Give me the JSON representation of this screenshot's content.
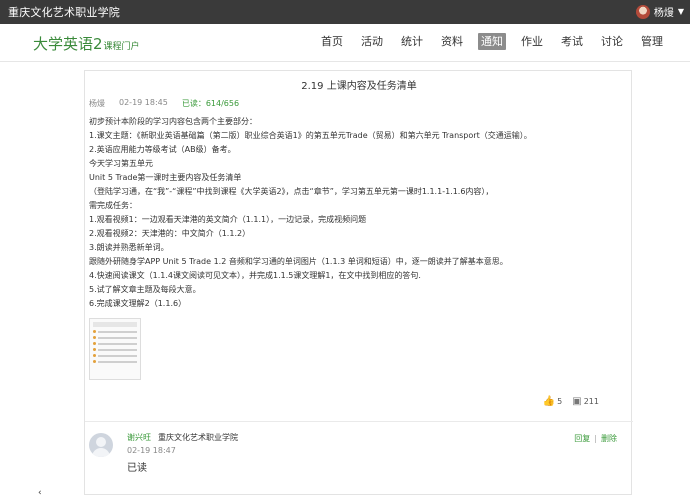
{
  "topbar": {
    "school_name": "重庆文化艺术职业学院",
    "user_name": "杨熳"
  },
  "header": {
    "brand_name": "大学英语2",
    "brand_sub": "课程门户",
    "nav": [
      "首页",
      "活动",
      "统计",
      "资料",
      "通知",
      "作业",
      "考试",
      "讨论",
      "管理"
    ],
    "active_nav": "通知"
  },
  "post": {
    "title": "2.19 上课内容及任务清单",
    "author": "杨熳",
    "time": "02-19 18:45",
    "read_status": "已读：614/656",
    "lines": [
      "初步预计本阶段的学习内容包含两个主要部分：",
      "1.课文主题：《新职业英语基础篇（第二版）职业综合英语1》的第五单元Trade（贸易）和第六单元 Transport（交通运输）。",
      "2.英语应用能力等级考试（AB级）备考。",
      "今天学习第五单元",
      "Unit 5 Trade第一课时主要内容及任务清单",
      "（登陆学习通，在“我”-“课程”中找到课程《大学英语2》，点击“章节”，学习第五单元第一课时1.1.1-1.1.6内容），",
      "需完成任务：",
      "1.观看视频1：一边观看天津港的英文简介（1.1.1），一边记录，完成视频问题",
      "2.观看视频2：天津港的：中文简介（1.1.2）",
      "3.朗读并熟悉新单词。",
      "跟随外研随身学APP  Unit 5 Trade 1.2 音频和学习通的单词图片（1.1.3 单词和短语）中，逐一朗读并了解基本意思。",
      "4.快速阅读课文（1.1.4课文阅读可见文本），并完成1.1.5课文理解1，在文中找到相应的答句.",
      "5.试了解文章主题及每段大意。",
      "6.完成课文理解2（1.1.6）"
    ],
    "likes": "5",
    "comments": "211"
  },
  "reply": {
    "name": "谢兴旺",
    "school": "重庆文化艺术职业学院",
    "time": "02-19 18:47",
    "text": "已读",
    "reply_label": "回复",
    "delete_label": "删除"
  },
  "icons": {
    "like": "thumbs-up-icon",
    "comment": "comment-icon",
    "user_menu": "chevron-down-icon"
  },
  "colors": {
    "brand_green": "#3a8a3a",
    "topbar_bg": "#3a3a3a",
    "active_nav_bg": "#8c8c8c"
  }
}
